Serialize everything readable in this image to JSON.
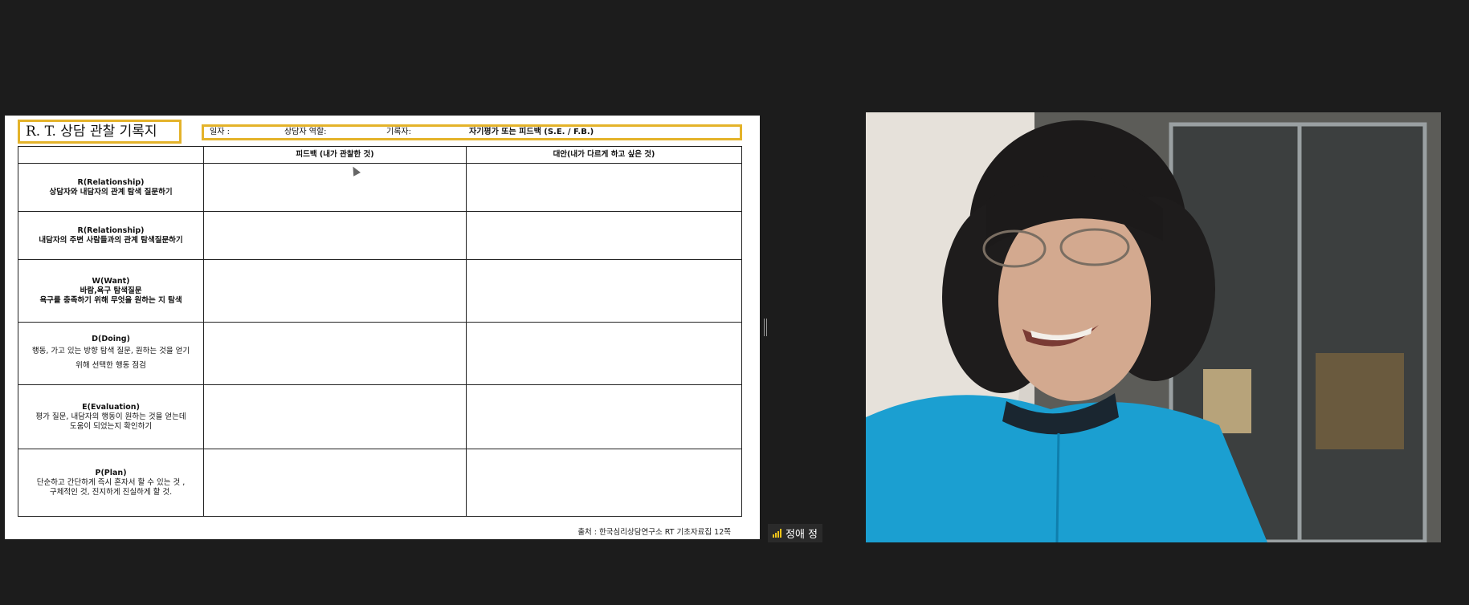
{
  "shared_document": {
    "title": "R. T. 상담 관찰 기록지",
    "meta": {
      "date_label": "일자 :",
      "role_label": "상담자 역할:",
      "recorder_label": "기록자:",
      "evaluation_label": "자기평가 또는 피드백 (S.E. / F.B.)"
    },
    "table": {
      "headers": [
        "",
        "피드백 (내가 관찰한 것)",
        "대안(내가 다르게 하고 싶은 것)"
      ],
      "rows": [
        {
          "title": "R(Relationship)",
          "desc": "상담자와 내담자의 관계 탐색 질문하기"
        },
        {
          "title": "R(Relationship)",
          "desc": "내담자의 주변 사람들과의 관계 탐색질문하기"
        },
        {
          "title": "W(Want)",
          "desc": "바람,욕구 탐색질문",
          "desc2": "욕구를 충족하기 위해 무엇을 원하는 지 탐색"
        },
        {
          "title": "D(Doing)",
          "desc": "행동, 가고 있는 방향 탐색 질문, 원하는 것을 얻기",
          "desc2": "위해 선택한 행동 점검"
        },
        {
          "title": "E(Evaluation)",
          "desc": "평가 질문, 내담자의 행동이 원하는 것을 얻는데",
          "desc2": "도움이 되었는지 확인하기"
        },
        {
          "title": "P(Plan)",
          "desc": "단순하고 간단하게 즉시 혼자서 할 수 있는 것 ,",
          "desc2": "구체적인 것, 진지하게 진실하게 할 것."
        }
      ]
    },
    "source": "출처 : 한국심리상담연구소 RT 기초자료집 12쪽"
  },
  "participant": {
    "name": "정애 정",
    "signal_icon": "signal-bars-icon",
    "signal_color": "#f0c419"
  },
  "colors": {
    "background": "#1c1c1c",
    "highlight_border": "#e4b32a"
  }
}
